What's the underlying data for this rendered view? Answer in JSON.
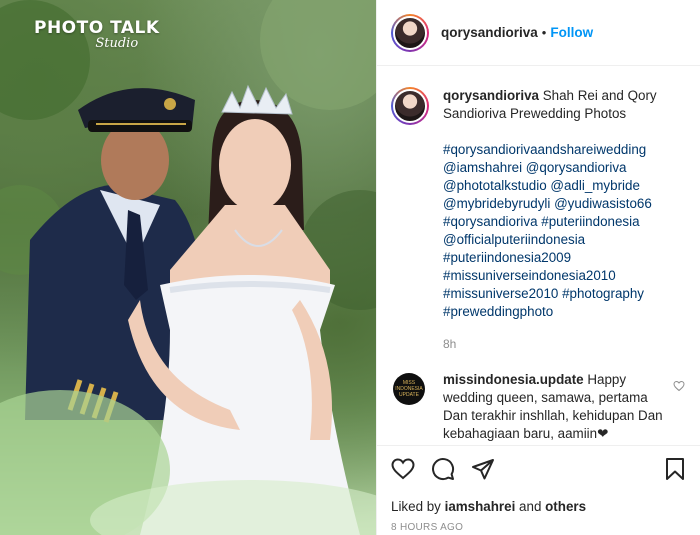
{
  "photo": {
    "watermark_main": "PHOTO TALK",
    "watermark_sub": "Studio"
  },
  "header": {
    "username": "qorysandioriva",
    "separator": "•",
    "follow_label": "Follow"
  },
  "caption": {
    "username": "qorysandioriva",
    "text": " Shah Rei and Qory Sandioriva Prewedding Photos",
    "hashtags": [
      "#qorysandiorivaandshareiwedding",
      "@iamshahrei @qorysandioriva",
      "@phototalkstudio @adli_mybride",
      "@mybridebyrudyli @yudiwasisto66",
      "#qorysandioriva #puteriindonesia",
      "@officialputeriindonesia",
      "#puteriindonesia2009",
      "#missuniverseindonesia2010",
      "#missuniverse2010 #photography",
      "#preweddingphoto"
    ],
    "age": "8h"
  },
  "comment": {
    "username": "missindonesia.update",
    "avatar_text": "MISS INDONESIA UPDATE",
    "text": " Happy wedding queen, samawa, pertama Dan terakhir inshllah, kehidupan Dan kebahagiaan baru, aamiin❤"
  },
  "actions": {
    "icons": [
      "heart-icon",
      "comment-icon",
      "share-icon",
      "bookmark-icon"
    ],
    "liked_by_prefix": "Liked by ",
    "liked_by_user": "iamshahrei",
    "liked_by_and": " and ",
    "liked_by_others": "others",
    "timestamp": "8 HOURS AGO"
  },
  "colors": {
    "link": "#0095f6",
    "hashtag": "#00376b",
    "muted": "#8e8e8e",
    "text": "#262626",
    "heart": "#ed4956"
  }
}
